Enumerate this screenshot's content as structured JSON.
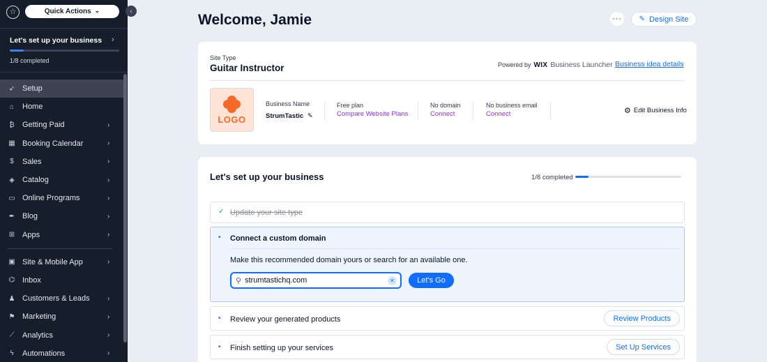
{
  "sidebar": {
    "quick_actions_label": "Quick Actions",
    "setup": {
      "title": "Let's set up your business",
      "progress": 0.125,
      "count": "1/8 completed"
    },
    "items": [
      {
        "label": "Setup",
        "icon": "rocket-icon",
        "glyph": "➶",
        "chevron": false,
        "active": true
      },
      {
        "label": "Home",
        "icon": "home-icon",
        "glyph": "⌂",
        "chevron": false
      },
      {
        "label": "Getting Paid",
        "icon": "payment-icon",
        "glyph": "₿",
        "chevron": true
      },
      {
        "label": "Booking Calendar",
        "icon": "calendar-icon",
        "glyph": "▦",
        "chevron": true
      },
      {
        "label": "Sales",
        "icon": "dollar-icon",
        "glyph": "$",
        "chevron": true
      },
      {
        "label": "Catalog",
        "icon": "tag-icon",
        "glyph": "◈",
        "chevron": true
      },
      {
        "label": "Online Programs",
        "icon": "laptop-icon",
        "glyph": "▭",
        "chevron": true
      },
      {
        "label": "Blog",
        "icon": "pen-nib-icon",
        "glyph": "✒",
        "chevron": true
      },
      {
        "label": "Apps",
        "icon": "apps-icon",
        "glyph": "⊞",
        "chevron": true
      }
    ],
    "items2": [
      {
        "label": "Site & Mobile App",
        "icon": "site-icon",
        "glyph": "▣",
        "chevron": true
      },
      {
        "label": "Inbox",
        "icon": "inbox-icon",
        "glyph": "⌬",
        "chevron": false
      },
      {
        "label": "Customers & Leads",
        "icon": "customers-icon",
        "glyph": "♟",
        "chevron": true
      },
      {
        "label": "Marketing",
        "icon": "megaphone-icon",
        "glyph": "⚑",
        "chevron": true
      },
      {
        "label": "Analytics",
        "icon": "chart-icon",
        "glyph": "⟋",
        "chevron": true
      },
      {
        "label": "Automations",
        "icon": "bolt-icon",
        "glyph": "ϟ",
        "chevron": true
      }
    ]
  },
  "header": {
    "welcome": "Welcome, Jamie",
    "more_label": "···",
    "design_site_label": "Design Site"
  },
  "business_card": {
    "site_type_label": "Site Type",
    "site_type": "Guitar Instructor",
    "powered_by": "Powered by",
    "wix": "WIX",
    "launcher": "Business Launcher",
    "idea_link": "Business idea details",
    "logo_text": "LOGO",
    "business_name_label": "Business Name",
    "business_name": "StrumTastic",
    "plan_label": "Free plan",
    "plan_link": "Compare Website Plans",
    "domain_label": "No domain",
    "domain_link": "Connect",
    "email_label": "No business email",
    "email_link": "Connect",
    "edit_label": "Edit Business Info"
  },
  "setup_card": {
    "title": "Let's set up your business",
    "count": "1/8 completed",
    "progress": 0.125,
    "tasks": {
      "t1": {
        "label": "Update your site type"
      },
      "t2": {
        "label": "Connect a custom domain",
        "desc": "Make this recommended domain yours or search for an available one.",
        "input_value": "strumtastichq.com",
        "button": "Let's Go"
      },
      "t3": {
        "label": "Review your generated products",
        "button": "Review Products"
      },
      "t4": {
        "label": "Finish setting up your services",
        "button": "Set Up Services"
      }
    }
  },
  "colors": {
    "accent": "#116dff",
    "sidebar_bg": "#161d2b",
    "link_purple": "#8b32d6",
    "logo_orange": "#f56a28"
  }
}
